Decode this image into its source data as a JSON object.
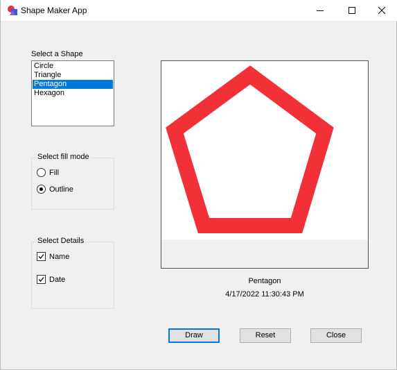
{
  "window": {
    "title": "Shape Maker App"
  },
  "shape_list": {
    "label": "Select a Shape",
    "items": [
      "Circle",
      "Triangle",
      "Pentagon",
      "Hexagon"
    ],
    "selected": "Pentagon"
  },
  "fill_mode": {
    "label": "Select fill mode",
    "options": [
      {
        "label": "Fill",
        "checked": false
      },
      {
        "label": "Outline",
        "checked": true
      }
    ]
  },
  "details": {
    "label": "Select Details",
    "options": [
      {
        "label": "Name",
        "checked": true
      },
      {
        "label": "Date",
        "checked": true
      }
    ]
  },
  "canvas": {
    "shape_name": "Pentagon",
    "date": "4/17/2022 11:30:43 PM",
    "outline_color": "#f23038"
  },
  "buttons": {
    "draw": "Draw",
    "reset": "Reset",
    "close": "Close"
  }
}
